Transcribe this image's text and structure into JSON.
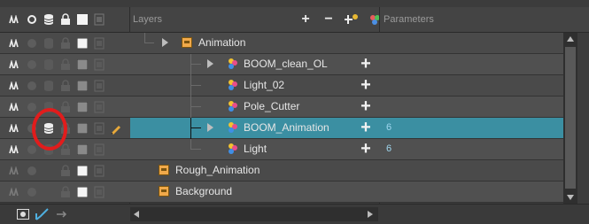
{
  "header": {
    "layers_label": "Layers",
    "parameters_label": "Parameters",
    "tools": [
      "add-layer",
      "remove-layer",
      "add-peg",
      "add-to-group"
    ]
  },
  "layers": [
    {
      "name": "Animation",
      "type": "group",
      "expandable": true,
      "has_plus": false,
      "param": ""
    },
    {
      "name": "BOOM_clean_OL",
      "type": "peg",
      "expandable": true,
      "has_plus": true,
      "param": ""
    },
    {
      "name": "Light_02",
      "type": "peg",
      "expandable": false,
      "has_plus": true,
      "param": ""
    },
    {
      "name": "Pole_Cutter",
      "type": "peg",
      "expandable": false,
      "has_plus": true,
      "param": ""
    },
    {
      "name": "BOOM_Animation",
      "type": "peg",
      "expandable": true,
      "has_plus": true,
      "param": "6",
      "selected": true
    },
    {
      "name": "Light",
      "type": "peg",
      "expandable": false,
      "has_plus": true,
      "param": "6"
    },
    {
      "name": "Rough_Animation",
      "type": "group",
      "expandable": false,
      "has_plus": false,
      "param": ""
    },
    {
      "name": "Background",
      "type": "group",
      "expandable": false,
      "has_plus": false,
      "param": ""
    }
  ],
  "colors": {
    "selection": "#3b8fa2",
    "highlight_circle": "#e11c1c",
    "group_icon": "#f0a94a"
  }
}
